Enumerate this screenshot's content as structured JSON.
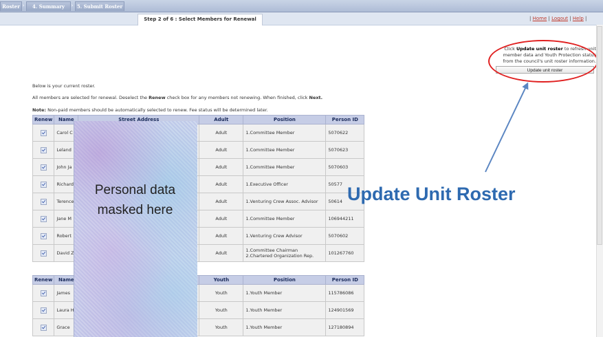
{
  "tabs": [
    "Roster",
    "4. Summary",
    "5. Submit Roster"
  ],
  "step_title": "Step 2 of 6 : Select Members for Renewal",
  "top_links": [
    "Home",
    "Logout",
    "Help"
  ],
  "panel": {
    "text_pre": "Click",
    "text_bold": "Update unit roster",
    "text_post": "to refresh unit member data and Youth Protection status from the council's unit roster information.",
    "button_label": "Update unit roster"
  },
  "intro": {
    "line1": "Below is your current roster.",
    "line2_a": "All members are selected for renewal. Deselect the",
    "line2_bold": "Renew",
    "line2_b": "check box for any members not renewing. When finished, click",
    "line2_bold2": "Next.",
    "note_label": "Note:",
    "note_text": "Non-paid members should be automatically selected to renew. Fee status will be determined later."
  },
  "adult_table": {
    "headers": [
      "Renew",
      "Name",
      "Street Address",
      "Adult",
      "Position",
      "Person ID"
    ],
    "rows": [
      {
        "name": "Carol C",
        "type": "Adult",
        "position": "1.Committee Member",
        "position2": "",
        "id": "5070622"
      },
      {
        "name": "Leland",
        "type": "Adult",
        "position": "1.Committee Member",
        "position2": "",
        "id": "5070623"
      },
      {
        "name": "John Ja",
        "type": "Adult",
        "position": "1.Committee Member",
        "position2": "",
        "id": "5070603"
      },
      {
        "name": "Richard",
        "type": "Adult",
        "position": "1.Executive Officer",
        "position2": "",
        "id": "50577"
      },
      {
        "name": "Terence",
        "type": "Adult",
        "position": "1.Venturing Crew Assoc. Advisor",
        "position2": "",
        "id": "50614"
      },
      {
        "name": "Jane M",
        "type": "Adult",
        "position": "1.Committee Member",
        "position2": "",
        "id": "106944211"
      },
      {
        "name": "Robert",
        "type": "Adult",
        "position": "1.Venturing Crew Advisor",
        "position2": "",
        "id": "5070602"
      },
      {
        "name": "David Z",
        "type": "Adult",
        "position": "1.Committee Chairman",
        "position2": "2.Chartered Organization Rep.",
        "id": "101267760"
      }
    ]
  },
  "youth_table": {
    "headers": [
      "Renew",
      "Name",
      "",
      "Youth",
      "Position",
      "Person ID"
    ],
    "rows": [
      {
        "name": "James",
        "type": "Youth",
        "position": "1.Youth Member",
        "id": "115786086"
      },
      {
        "name": "Laura H",
        "type": "Youth",
        "position": "1.Youth Member",
        "id": "124901569"
      },
      {
        "name": "Grace",
        "type": "Youth",
        "position": "1.Youth Member",
        "id": "127180894"
      }
    ]
  },
  "mask_text": "Personal data masked here",
  "callout": "Update Unit Roster",
  "colors": {
    "callout": "#2e6ab0",
    "ellipse": "#e02020",
    "arrow": "#5b86c2"
  }
}
